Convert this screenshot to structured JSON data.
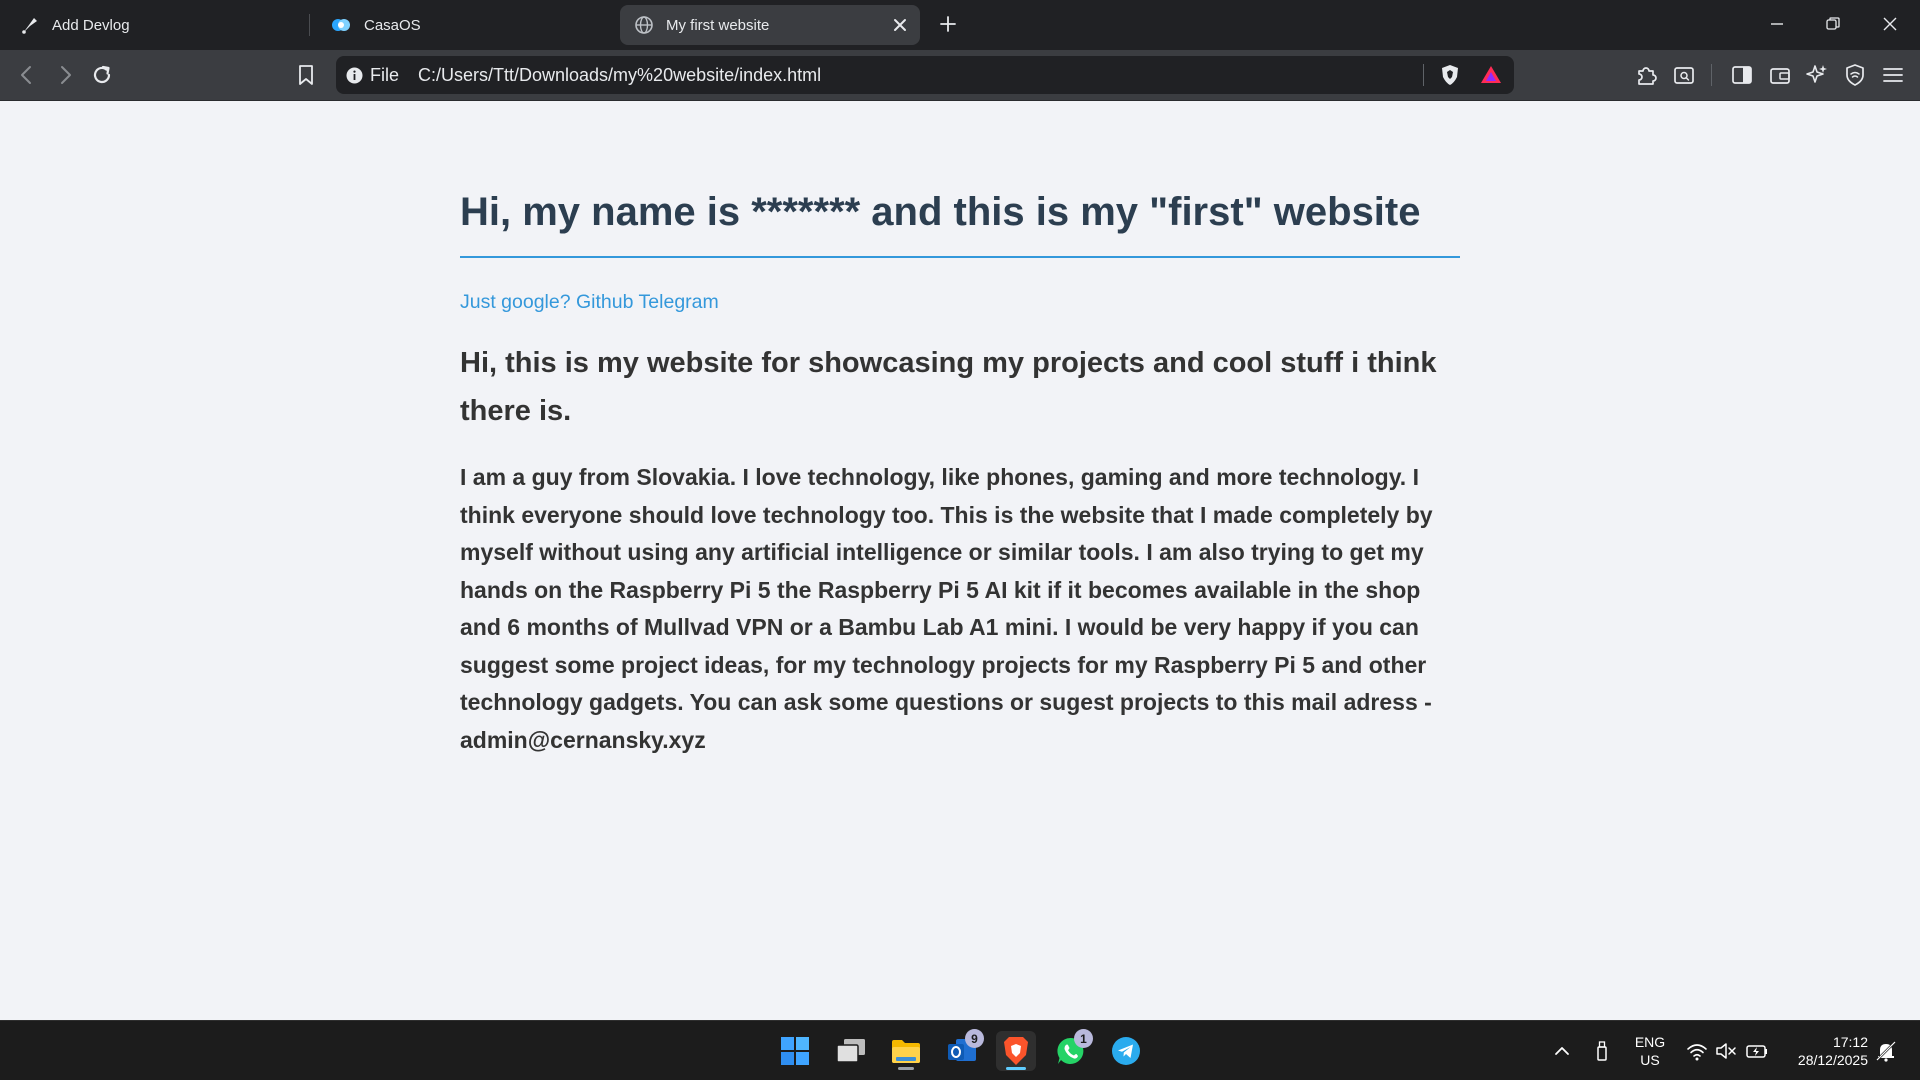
{
  "tabs": [
    {
      "label": "Add Devlog",
      "icon": "pen-nib-icon"
    },
    {
      "label": "CasaOS",
      "icon": "casaos-icon"
    },
    {
      "label": "My first website",
      "icon": "globe-icon",
      "active": true
    }
  ],
  "omnibox": {
    "scheme_label": "File",
    "url": "C:/Users/Ttt/Downloads/my%20website/index.html"
  },
  "page": {
    "title": "Hi, my name is ******* and this is my \"first\" website",
    "links": [
      {
        "label": "Just google?"
      },
      {
        "label": "Github"
      },
      {
        "label": "Telegram"
      }
    ],
    "intro": "Hi, this is my website for showcasing my projects and cool stuff i think there is.",
    "body": "I am a guy from Slovakia. I love technology, like phones, gaming and more technology. I think everyone should love technology too. This is the website that I made completely by myself without using any artificial intelligence or similar tools. I am also trying to get my hands on the Raspberry Pi 5 the Raspberry Pi 5 AI kit if it becomes available in the shop and 6 months of Mullvad VPN or a Bambu Lab A1 mini. I would be very happy if you can suggest some project ideas, for my technology projects for my Raspberry Pi 5 and other technology gadgets. You can ask some questions or sugest projects to this mail adress - admin@cernansky.xyz"
  },
  "taskbar": {
    "apps": [
      {
        "name": "start-button"
      },
      {
        "name": "task-view-button"
      },
      {
        "name": "file-explorer-button"
      },
      {
        "name": "outlook-button",
        "badge": "9"
      },
      {
        "name": "brave-browser-button",
        "active": true
      },
      {
        "name": "whatsapp-button",
        "badge": "1"
      },
      {
        "name": "telegram-button"
      }
    ],
    "language_line1": "ENG",
    "language_line2": "US",
    "time": "17:12",
    "date": "28/12/2025"
  },
  "colors": {
    "title": "#2c3e50",
    "link": "#3498db",
    "text": "#333333",
    "rule": "#3498db",
    "page_bg": "#f2f3f7",
    "chrome_dark": "#202124",
    "chrome_toolbar": "#3b3d41",
    "taskbar_bg": "#1c1c1c",
    "active_indicator": "#60cdff"
  }
}
